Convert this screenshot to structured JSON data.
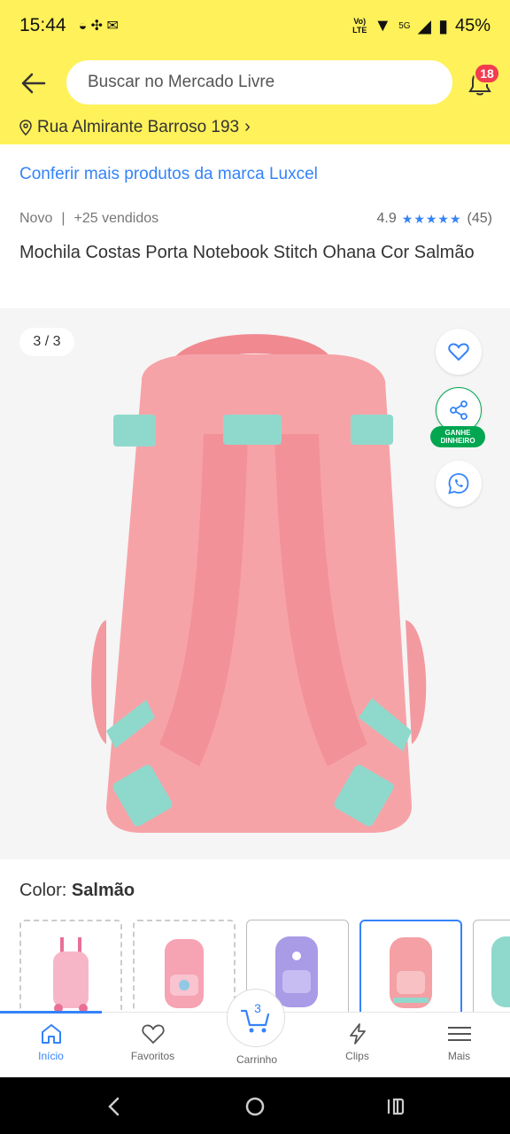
{
  "status_bar": {
    "time": "15:44",
    "network": "5G",
    "battery": "45%"
  },
  "header": {
    "search_placeholder": "Buscar no Mercado Livre",
    "notifications_count": "18",
    "address": "Rua Almirante Barroso 193"
  },
  "product": {
    "brand_link": "Conferir mais produtos da marca Luxcel",
    "condition": "Novo",
    "separator": "|",
    "sold": "+25 vendidos",
    "rating": "4.9",
    "stars": "★★★★★",
    "review_count": "(45)",
    "title": "Mochila Costas Porta Notebook Stitch Ohana Cor Salmão"
  },
  "gallery": {
    "counter": "3 / 3",
    "earn_tag_line1": "GANHE",
    "earn_tag_line2": "DINHEIRO"
  },
  "color": {
    "label": "Color:",
    "value": "Salmão",
    "options": [
      "rosa-rodinhas",
      "rosa",
      "lilás",
      "salmão",
      "verde"
    ]
  },
  "bottom_nav": {
    "items": [
      {
        "label": "Início",
        "icon": "home-icon"
      },
      {
        "label": "Favoritos",
        "icon": "heart-icon"
      },
      {
        "label": "Carrinho",
        "icon": "cart-icon"
      },
      {
        "label": "Clips",
        "icon": "lightning-icon"
      },
      {
        "label": "Mais",
        "icon": "menu-icon"
      }
    ],
    "cart_count": "3"
  },
  "colors": {
    "header_yellow": "#fff159",
    "link_blue": "#3483fa",
    "green": "#00a650",
    "badge_red": "#f23d4f",
    "backpack_pink": "#f4a0a4",
    "strap_mint": "#8fd9cc"
  }
}
